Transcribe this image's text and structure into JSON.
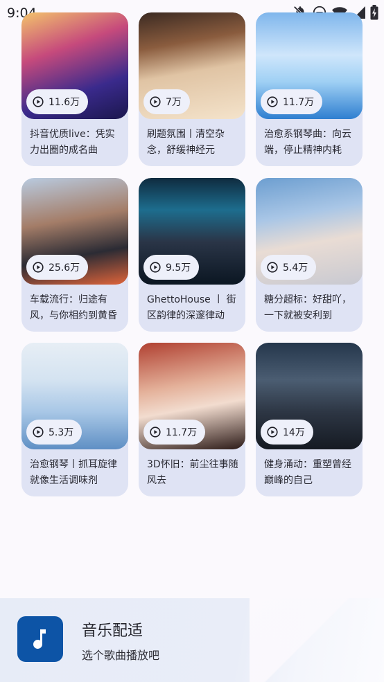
{
  "status_bar": {
    "time": "9:04"
  },
  "cards": [
    {
      "plays": "11.6万",
      "title": "抖音优质live：凭实力出圈的成名曲",
      "art": "linear-gradient(160deg,#f3c36b 0%,#c64a7c 35%,#3a2a8c 70%,#1b174d 100%)"
    },
    {
      "plays": "7万",
      "title": "刷题氛围丨清空杂念，舒缓神经元",
      "art": "linear-gradient(170deg,#3b2a22 0%,#8a5c3e 30%,#e0c4a4 55%,#f4e3cb 100%)"
    },
    {
      "plays": "11.7万",
      "title": "治愈系钢琴曲：向云端，停止精神内耗",
      "art": "linear-gradient(180deg,#7fb6ec 0%,#cfe6fb 40%,#9fd0f4 65%,#2f7fd0 100%)"
    },
    {
      "plays": "25.6万",
      "title": "车载流行：归途有风，与你相约到黄昏",
      "art": "linear-gradient(170deg,#b9cbe0 0%,#a47d68 40%,#2b2b34 70%,#e0643a 100%)"
    },
    {
      "plays": "9.5万",
      "title": "GhettoHouse 丨 街区韵律的深邃律动",
      "art": "linear-gradient(180deg,#0f2b3f 0%,#1d6d8e 30%,#2a3547 60%,#0b1622 100%)"
    },
    {
      "plays": "5.4万",
      "title": "糖分超标：好甜吖，一下就被安利到",
      "art": "linear-gradient(170deg,#6c9ed0 0%,#a9c6e6 35%,#e9dcd4 60%,#c8c9d1 100%)"
    },
    {
      "plays": "5.3万",
      "title": "治愈钢琴丨抓耳旋律就像生活调味剂",
      "art": "linear-gradient(180deg,#e7eef5 0%,#d4e3f1 35%,#a8c7e6 65%,#5f8fc4 100%)"
    },
    {
      "plays": "11.7万",
      "title": "3D怀旧：前尘往事随风去",
      "art": "linear-gradient(170deg,#b04031 0%,#e4b19a 40%,#f2dccf 60%,#2c1a17 100%)"
    },
    {
      "plays": "14万",
      "title": "健身涌动：重塑曾经巅峰的自己",
      "art": "linear-gradient(180deg,#25374c 0%,#4b5d72 35%,#2d3644 65%,#151a22 100%)"
    }
  ],
  "player": {
    "title": "音乐配适",
    "subtitle": "选个歌曲播放吧"
  }
}
